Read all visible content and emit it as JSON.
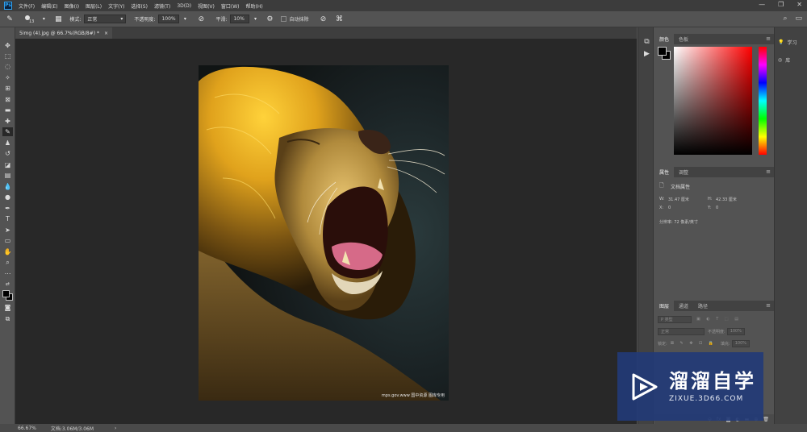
{
  "app": {
    "logo_text": "Ps"
  },
  "menu": [
    "文件(F)",
    "编辑(E)",
    "图像(I)",
    "图层(L)",
    "文字(Y)",
    "选择(S)",
    "滤镜(T)",
    "3D(D)",
    "视图(V)",
    "窗口(W)",
    "帮助(H)"
  ],
  "window_controls": [
    "—",
    "❐",
    "✕"
  ],
  "options": {
    "brush_size": "13",
    "mode_label": "模式:",
    "mode_value": "正常",
    "opacity_label": "不透明度:",
    "opacity_value": "100%",
    "smoothing_label": "平滑:",
    "smoothing_value": "10%",
    "auto_erase_label": "自动抹除"
  },
  "document": {
    "tab_title": "5img (4).jpg @ 66.7%(RGB/8#) *",
    "tab_close": "×",
    "image_caption": "mps.gov.www  国中资源 图库专用"
  },
  "status": {
    "zoom": "66.67%",
    "doc_info": "文档:3.06M/3.06M",
    "arrow": "›"
  },
  "panels": {
    "color_tabs": [
      "颜色",
      "色板"
    ],
    "properties_tabs": [
      "属性",
      "调整"
    ],
    "properties_title": "文档属性",
    "props": {
      "w_label": "W:",
      "w_value": "31.47 厘米",
      "h_label": "H:",
      "h_value": "42.33 厘米",
      "x_label": "X:",
      "x_value": "0",
      "y_label": "Y:",
      "y_value": "0",
      "resolution": "分辨率: 72 像素/英寸"
    },
    "layers_tabs": [
      "图层",
      "通道",
      "路径"
    ],
    "layers": {
      "filter_placeholder": "P 类型",
      "blend_mode": "正常",
      "opacity_label": "不透明度:",
      "opacity_value": "100%",
      "lock_label": "锁定:",
      "fill_label": "填充:",
      "fill_value": "100%"
    },
    "menu_icon": "≡"
  },
  "right_strip": {
    "learn": "学习",
    "library": "库"
  },
  "watermark": {
    "name": "溜溜自学",
    "url": "ZIXUE.3D66.COM"
  },
  "colors": {
    "foreground": "#000000",
    "background": "#000000",
    "badge": "#223a76"
  }
}
